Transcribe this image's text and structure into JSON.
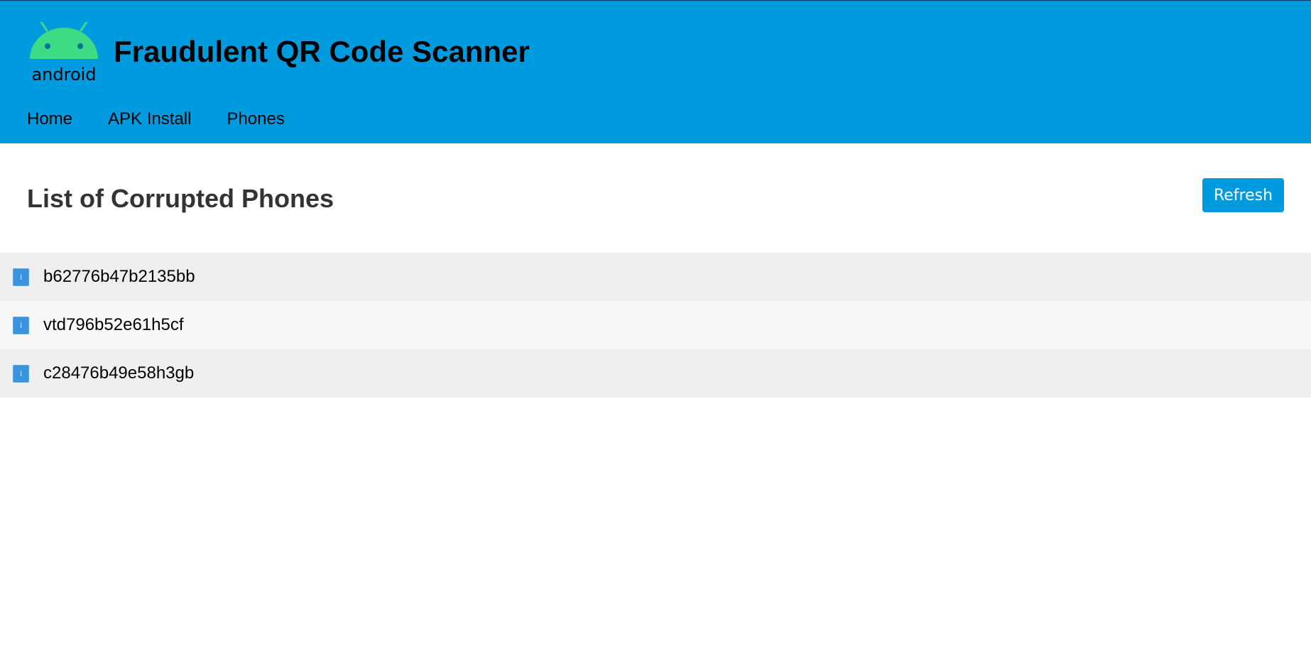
{
  "header": {
    "logo_text": "android",
    "title": "Fraudulent QR Code Scanner",
    "nav": [
      {
        "label": "Home"
      },
      {
        "label": "APK Install"
      },
      {
        "label": "Phones"
      }
    ]
  },
  "main": {
    "heading": "List of Corrupted Phones",
    "refresh_label": "Refresh",
    "info_icon_glyph": "i",
    "phones": [
      {
        "id": "b62776b47b2135bb"
      },
      {
        "id": "vtd796b52e61h5cf"
      },
      {
        "id": "c28476b49e58h3gb"
      }
    ]
  },
  "colors": {
    "header_bg": "#009ade",
    "android_green": "#3ddc84",
    "button_bg": "#009ade",
    "info_icon_bg": "#3b94db"
  }
}
